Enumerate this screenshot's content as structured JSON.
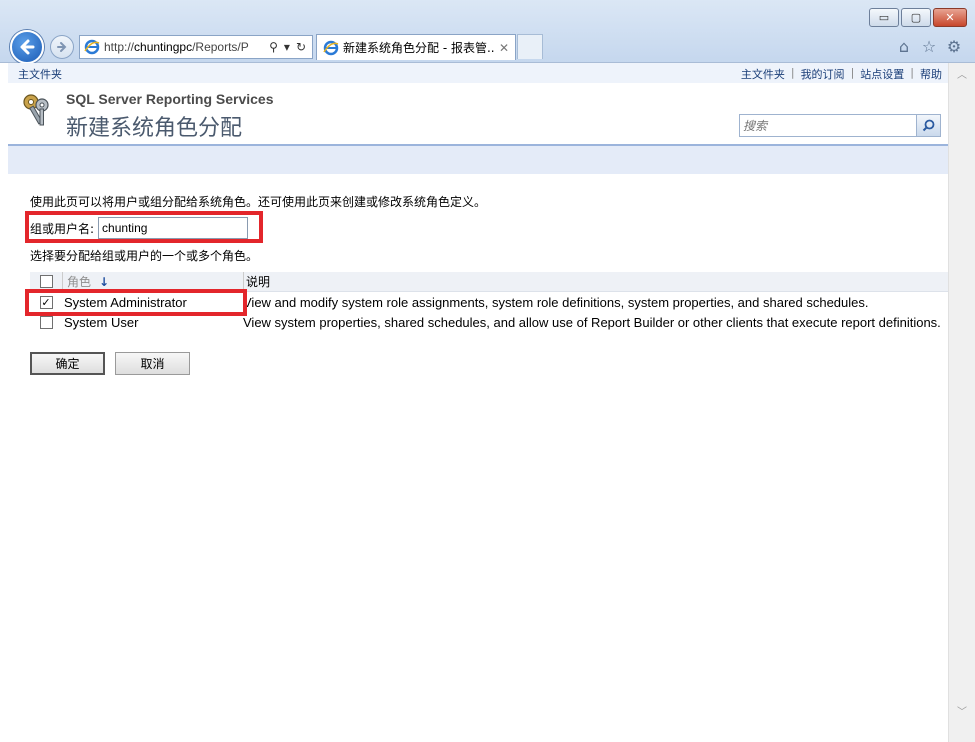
{
  "browser": {
    "address_url_prefix": "http://",
    "address_host": "chuntingpc",
    "address_path": "/Reports/P",
    "tab_title": "新建系统角色分配 - 报表管...",
    "window_minimize": "▭",
    "window_restore": "▢",
    "window_close": "✕"
  },
  "toplinks": {
    "home": "主文件夹",
    "right": [
      "主文件夹",
      "我的订阅",
      "站点设置",
      "帮助"
    ],
    "separator": "|"
  },
  "header": {
    "product": "SQL Server Reporting Services",
    "title": "新建系统角色分配",
    "search_placeholder": "搜索"
  },
  "form": {
    "description": "使用此页可以将用户或组分配给系统角色。还可使用此页来创建或修改系统角色定义。",
    "user_label": "组或用户名:",
    "user_value": "chunting",
    "select_description": "选择要分配给组或用户的一个或多个角色。"
  },
  "grid": {
    "col_role": "角色",
    "col_desc": "说明",
    "sort_arrow": "↓",
    "rows": [
      {
        "checked": true,
        "role": "System Administrator",
        "desc": "View and modify system role assignments, system role definitions, system properties, and shared schedules."
      },
      {
        "checked": false,
        "role": "System User",
        "desc": "View system properties, shared schedules, and allow use of Report Builder or other clients that execute report definitions."
      }
    ]
  },
  "buttons": {
    "ok": "确定",
    "cancel": "取消"
  },
  "colors": {
    "highlight_red": "#e3262b",
    "link_blue": "#1a3e78"
  }
}
